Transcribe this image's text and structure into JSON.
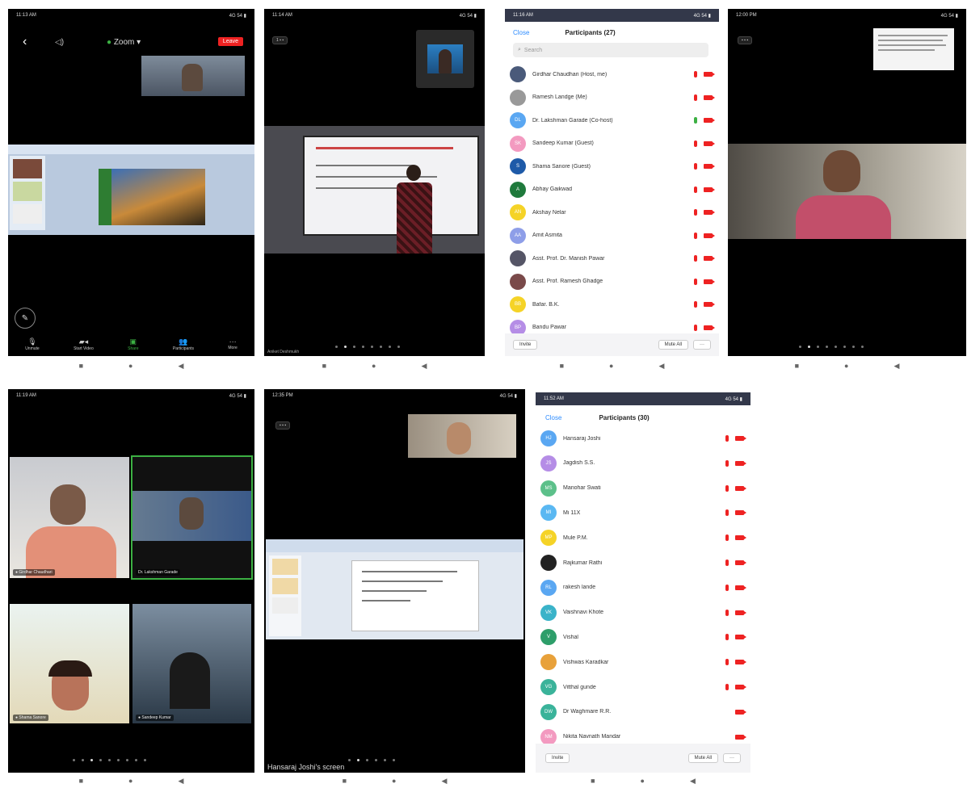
{
  "p1": {
    "status_time": "11:13 AM",
    "status_right": "4G 54 ▮",
    "meeting_name": "Zoom",
    "leave_label": "Leave",
    "toolbar": [
      {
        "label": "Unmute",
        "icon": "mic-icon"
      },
      {
        "label": "Start Video",
        "icon": "video-icon"
      },
      {
        "label": "Share",
        "icon": "share-icon"
      },
      {
        "label": "Participants",
        "icon": "participants-icon"
      },
      {
        "label": "More",
        "icon": "more-icon"
      }
    ]
  },
  "p2": {
    "status_time": "11:14 AM",
    "status_right": "4G 54 ▮",
    "top_badge": "1 ▪ ▪",
    "bottom_left": "Aniket Deshmukh"
  },
  "p3": {
    "status_time": "11:16 AM",
    "status_right": "4G 54 ▮",
    "close_label": "Close",
    "title": "Participants (27)",
    "search_placeholder": "Search",
    "participants": [
      {
        "name": "Girdhar Chaudhari (Host, me)",
        "initials": "",
        "color": "#4a5a7a",
        "mic": "#e22"
      },
      {
        "name": "Ramesh Landge (Me)",
        "initials": "",
        "color": "#999",
        "mic": "#e22"
      },
      {
        "name": "Dr. Lakshman Garade (Co-host)",
        "initials": "DL",
        "color": "#5aa7f2",
        "mic": "#3cb043"
      },
      {
        "name": "Sandeep Kumar (Guest)",
        "initials": "SK",
        "color": "#f39ac0",
        "mic": "#e22"
      },
      {
        "name": "Shama Sanore (Guest)",
        "initials": "S",
        "color": "#1e5aa8",
        "mic": "#e22"
      },
      {
        "name": "Abhay Gaikwad",
        "initials": "A",
        "color": "#1f7a3c",
        "mic": "#e22"
      },
      {
        "name": "Akshay Nelar",
        "initials": "AN",
        "color": "#f5d327",
        "mic": "#e22"
      },
      {
        "name": "Amit Asmita",
        "initials": "AA",
        "color": "#8e9ee8",
        "mic": "#e22"
      },
      {
        "name": "Asst. Prof. Dr. Manish Pawar",
        "initials": "",
        "color": "#556",
        "mic": "#e22"
      },
      {
        "name": "Asst. Prof. Ramesh Ghadge",
        "initials": "",
        "color": "#7a4a4a",
        "mic": "#e22"
      },
      {
        "name": "Bafar. B.K.",
        "initials": "BB",
        "color": "#f5d327",
        "mic": "#e22"
      },
      {
        "name": "Bandu Pawar",
        "initials": "BP",
        "color": "#b58de6",
        "mic": "#e22"
      }
    ],
    "invite_label": "Invite",
    "mute_all_label": "Mute All",
    "more_label": "···"
  },
  "p4": {
    "status_time": "12:00 PM",
    "status_right": "4G 54 ▮",
    "top_badge": "▪ ▪ ▪"
  },
  "p5": {
    "status_time": "11:19 AM",
    "status_right": "4G 54 ▮",
    "tiles": [
      {
        "name": "Girdhar Chaudhari"
      },
      {
        "name": "Dr. Lakshman Garade"
      },
      {
        "name": "Shama Sanore"
      },
      {
        "name": "Sandeep Kumar"
      }
    ]
  },
  "p6": {
    "status_time": "12:35 PM",
    "status_right": "4G 54 ▮",
    "top_badge": "▪ ▪ ▪",
    "screen_label": "Hansaraj Joshi's screen"
  },
  "p7": {
    "status_time": "11:52 AM",
    "status_right": "4G 54 ▮",
    "close_label": "Close",
    "title": "Participants (30)",
    "participants": [
      {
        "name": "Hansaraj Joshi",
        "initials": "HJ",
        "color": "#5aa7f2",
        "mic": true
      },
      {
        "name": "Jagdish S.S.",
        "initials": "JS",
        "color": "#b58de6",
        "mic": true
      },
      {
        "name": "Manohar Swati",
        "initials": "MS",
        "color": "#5cc08a",
        "mic": true
      },
      {
        "name": "Mi 11X",
        "initials": "MI",
        "color": "#5ab8f2",
        "mic": true
      },
      {
        "name": "Mule P.M.",
        "initials": "MP",
        "color": "#f5d327",
        "mic": true
      },
      {
        "name": "Rajkumar Rathi",
        "initials": "",
        "color": "#222",
        "mic": true
      },
      {
        "name": "rakesh lande",
        "initials": "RL",
        "color": "#5aa7f2",
        "mic": true
      },
      {
        "name": "Vaishnavi Khote",
        "initials": "VK",
        "color": "#3ab3c9",
        "mic": true
      },
      {
        "name": "Vishal",
        "initials": "V",
        "color": "#2e9e6a",
        "mic": true
      },
      {
        "name": "Vishwas Karadkar",
        "initials": "",
        "color": "#e8a13a",
        "mic": true
      },
      {
        "name": "Vitthal gunde",
        "initials": "VG",
        "color": "#3ab39a",
        "mic": true
      },
      {
        "name": "Dr Waghmare R.R.",
        "initials": "DW",
        "color": "#3ab39a",
        "mic": false
      },
      {
        "name": "Nikita Navnath Mandar",
        "initials": "NM",
        "color": "#f39ac0",
        "mic": false
      }
    ],
    "invite_label": "Invite",
    "mute_all_label": "Mute All",
    "more_label": "···"
  },
  "nav": {
    "square": "■",
    "circle": "●",
    "back": "◀"
  }
}
